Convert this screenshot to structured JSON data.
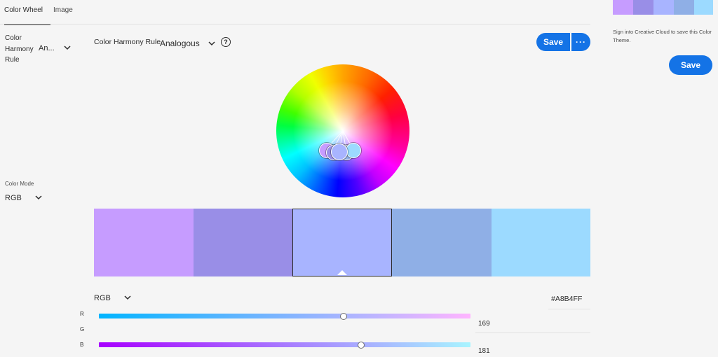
{
  "tabs": [
    {
      "label": "Color Wheel",
      "active": true
    },
    {
      "label": "Image",
      "active": false
    }
  ],
  "sidebar": {
    "harmony_label_line1": "Color",
    "harmony_label_line2": "Harmony",
    "harmony_label_line3": "Rule",
    "harmony_value": "An...",
    "color_mode_label": "Color Mode",
    "color_mode_value": "RGB"
  },
  "header": {
    "harmony_rule_label": "Color Harmony Rule",
    "harmony_rule_value": "Analogous",
    "help_glyph": "?",
    "save_label": "Save",
    "more_label": "···"
  },
  "swatches": [
    {
      "hex": "#C69CFF"
    },
    {
      "hex": "#998EE7"
    },
    {
      "hex": "#A8B4FF",
      "selected": true
    },
    {
      "hex": "#8FAFE6"
    },
    {
      "hex": "#9CDAFF"
    }
  ],
  "editor": {
    "mode_value": "RGB",
    "hex_value": "#A8B4FF",
    "channels": [
      {
        "label": "R",
        "value": "169",
        "level": 0.656
      },
      {
        "label": "G",
        "value": "",
        "level": null
      },
      {
        "label": "B",
        "value": "181",
        "level": 0.702
      }
    ]
  },
  "right_panel": {
    "sign_in_text": "Sign into Creative Cloud to save this Color Theme.",
    "save_label": "Save",
    "mini_swatches": [
      "#C69CFF",
      "#998EE7",
      "#A8B4FF",
      "#8FAFE6",
      "#9CDAFF"
    ]
  },
  "colors": {
    "accent": "#1473e6",
    "background": "#f5f5f5"
  },
  "icons": {
    "chevron": "chevron-down-icon",
    "help": "help-circle-icon",
    "more": "more-icon"
  }
}
